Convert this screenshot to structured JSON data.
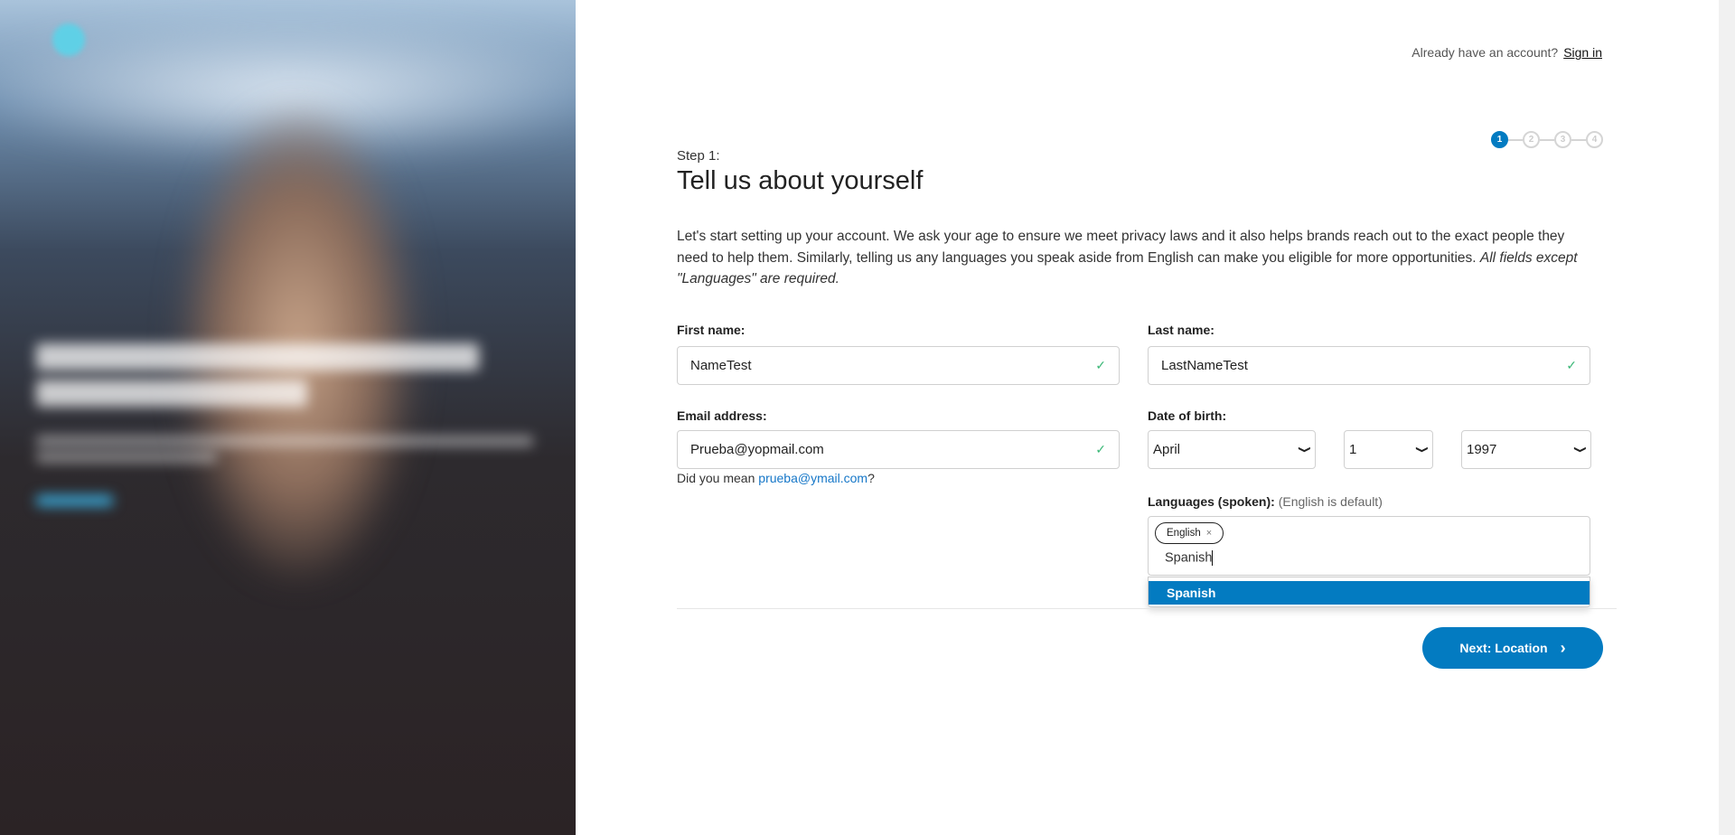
{
  "header": {
    "signin_prompt": "Already have an account?",
    "signin_link": "Sign in"
  },
  "stepper": {
    "steps": [
      "1",
      "2",
      "3",
      "4"
    ],
    "current": 1
  },
  "form": {
    "step_label": "Step 1:",
    "title": "Tell us about yourself",
    "intro": "Let's start setting up your account. We ask your age to ensure we meet privacy laws and it also helps brands reach out to the exact people they need to help them. Similarly, telling us any languages you speak aside from English can make you eligible for more opportunities.",
    "intro_italic": "All fields except \"Languages\" are required.",
    "first_name": {
      "label": "First name:",
      "value": "NameTest"
    },
    "last_name": {
      "label": "Last name:",
      "value": "LastNameTest"
    },
    "email": {
      "label": "Email address:",
      "value": "Prueba@yopmail.com"
    },
    "email_hint": {
      "prefix": "Did you mean ",
      "suggestion": "prueba@ymail.com",
      "suffix": "?"
    },
    "dob": {
      "label": "Date of birth:",
      "month": "April",
      "day": "1",
      "year": "1997"
    },
    "languages": {
      "label": "Languages (spoken):",
      "note": "(English is default)",
      "chips": [
        "English"
      ],
      "typed": "Spanish",
      "options": [
        "Spanish"
      ]
    },
    "next_label": "Next: Location"
  },
  "icons": {
    "check": "✓",
    "chevron": "⌄",
    "remove": "×",
    "next": "›"
  },
  "colors": {
    "accent": "#037bc1",
    "valid": "#3cb878"
  }
}
